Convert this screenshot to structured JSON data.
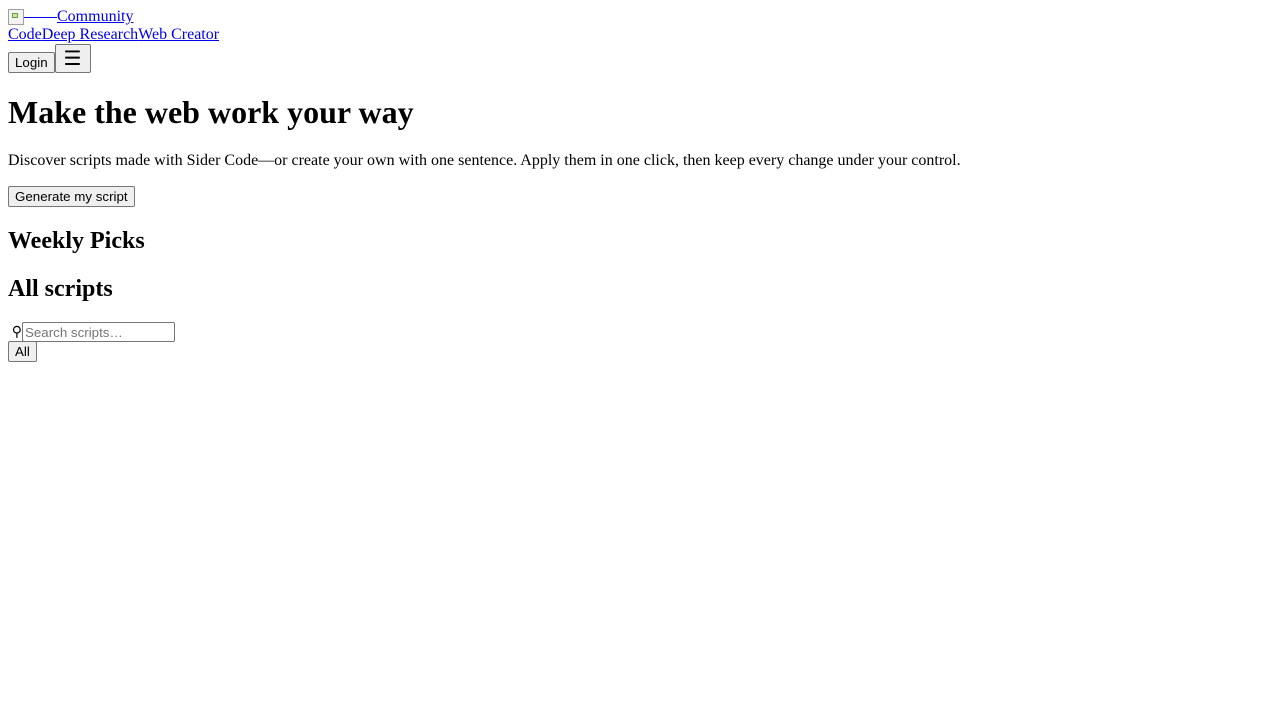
{
  "header": {
    "brand": {
      "logo_icon": "broken-image-icon",
      "label": "Community"
    },
    "nav": [
      {
        "label": "Code"
      },
      {
        "label": "Deep Research"
      },
      {
        "label": "Web Creator"
      }
    ],
    "login_label": "Login",
    "menu_icon": "☰"
  },
  "hero": {
    "title": "Make the web work your way",
    "description": "Discover scripts made with Sider Code—or create your own with one sentence. Apply them in one click, then keep every change under your control.",
    "cta_label": "Generate my script"
  },
  "weekly": {
    "title": "Weekly Picks"
  },
  "all_scripts": {
    "title": "All scripts",
    "search_icon": "⚲",
    "search_placeholder": "Search scripts…",
    "filters": [
      {
        "label": "All"
      }
    ]
  },
  "colors": {
    "link": "#0000ee",
    "text": "#000000",
    "button_bg": "#efefef",
    "button_border": "#767676"
  }
}
